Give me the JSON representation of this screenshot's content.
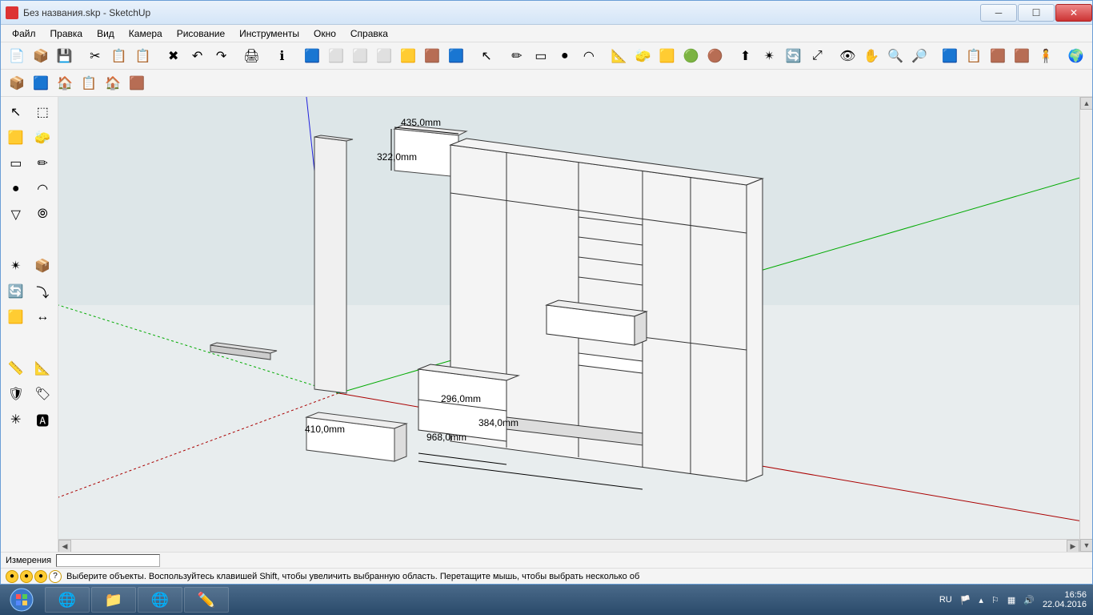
{
  "window": {
    "title": "Без названия.skp - SketchUp"
  },
  "menu": {
    "items": [
      "Файл",
      "Правка",
      "Вид",
      "Камера",
      "Рисование",
      "Инструменты",
      "Окно",
      "Справка"
    ]
  },
  "dimensions": {
    "d1": "435,0mm",
    "d2": "322,0mm",
    "d3": "296,0mm",
    "d4": "384,0mm",
    "d5": "968,0mm",
    "d6": "410,0mm"
  },
  "status": {
    "measure_label": "Измерения",
    "measure_value": "",
    "hint": "Выберите объекты. Воспользуйтесь клавишей Shift, чтобы увеличить выбранную область. Перетащите мышь, чтобы выбрать несколько об"
  },
  "taskbar": {
    "lang": "RU",
    "time": "16:56",
    "date": "22.04.2016"
  },
  "icons": {
    "toolbar1": [
      "📄",
      "📦",
      "💾",
      "·",
      "✂",
      "📋",
      "📋",
      "·",
      "✖",
      "↶",
      "↷",
      "·",
      "🖨",
      "·",
      "ℹ",
      "·",
      "🟦",
      "⬜",
      "⬜",
      "⬜",
      "🟨",
      "🟫",
      "🟦",
      "·",
      "↖",
      "·",
      "✏",
      "▭",
      "●",
      "◠",
      "·",
      "📐",
      "🧽",
      "🟨",
      "🟢",
      "🟤",
      "·",
      "⬆",
      "✴",
      "🔄",
      "⤢",
      "·",
      "👁",
      "✋",
      "🔍",
      "🔎",
      "·",
      "🟦",
      "📋",
      "🟫",
      "🟫",
      "🧍",
      "·",
      "🌍"
    ],
    "toolbar2": [
      "📦",
      "🟦",
      "🏠",
      "📋",
      "🏠",
      "🟫"
    ],
    "left_tools": [
      [
        "↖",
        "⬚"
      ],
      [
        "🟨",
        "🧽"
      ],
      [
        "▭",
        "✏"
      ],
      [
        "●",
        "◠"
      ],
      [
        "▽",
        "⦾"
      ],
      [
        "·",
        "·"
      ],
      [
        "✴",
        "📦"
      ],
      [
        "🔄",
        "⤵"
      ],
      [
        "🟨",
        "↔"
      ],
      [
        "·",
        "·"
      ],
      [
        "📏",
        "📐"
      ],
      [
        "🛡",
        "🏷"
      ],
      [
        "✳",
        "🅰"
      ]
    ]
  }
}
